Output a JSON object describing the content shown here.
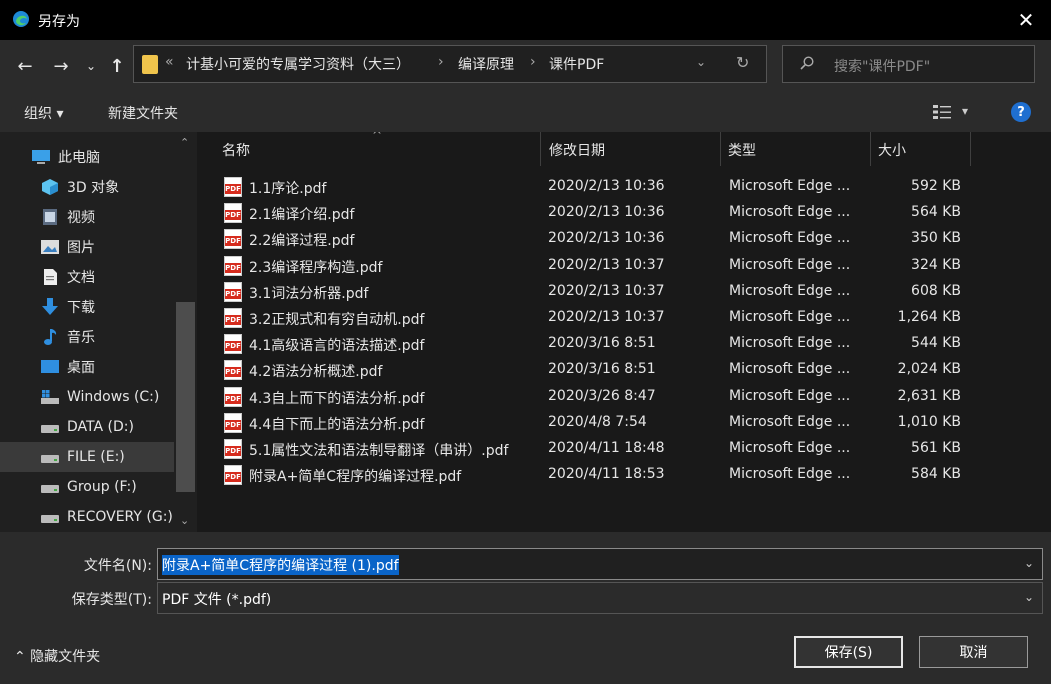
{
  "window": {
    "title": "另存为",
    "close_glyph": "✕"
  },
  "nav": {
    "back_glyph": "←",
    "forward_glyph": "→",
    "recent_glyph": "⌄",
    "up_glyph": "↑",
    "breadcrumb_overflow": "«",
    "breadcrumbs": [
      "计基小可爱的专属学习资料（大三）",
      "编译原理",
      "课件PDF"
    ],
    "separator": "›",
    "dropdown_glyph": "⌄",
    "refresh_glyph": "↻",
    "search_placeholder": "搜索\"课件PDF\""
  },
  "commandbar": {
    "organize": "组织 ▾",
    "new_folder": "新建文件夹",
    "view_dropdown": "▾",
    "help": "?"
  },
  "sidebar": {
    "items": [
      {
        "label": "此电脑",
        "icon": "computer-icon"
      },
      {
        "label": "3D 对象",
        "icon": "3d-objects-icon"
      },
      {
        "label": "视频",
        "icon": "video-icon"
      },
      {
        "label": "图片",
        "icon": "pictures-icon"
      },
      {
        "label": "文档",
        "icon": "documents-icon"
      },
      {
        "label": "下载",
        "icon": "download-icon"
      },
      {
        "label": "音乐",
        "icon": "music-icon"
      },
      {
        "label": "桌面",
        "icon": "desktop-icon"
      },
      {
        "label": "Windows (C:)",
        "icon": "system-drive-icon"
      },
      {
        "label": "DATA (D:)",
        "icon": "drive-icon"
      },
      {
        "label": "FILE (E:)",
        "icon": "drive-icon",
        "selected": true
      },
      {
        "label": "Group (F:)",
        "icon": "drive-icon"
      },
      {
        "label": "RECOVERY (G:)",
        "icon": "drive-icon"
      }
    ],
    "scroll_up": "⌃",
    "scroll_down": "⌄"
  },
  "columns": {
    "name": "名称",
    "modified": "修改日期",
    "type": "类型",
    "size": "大小",
    "sort_caret": "^"
  },
  "files": [
    {
      "name": "1.1序论.pdf",
      "modified": "2020/2/13 10:36",
      "type": "Microsoft Edge ...",
      "size": "592 KB"
    },
    {
      "name": "2.1编译介绍.pdf",
      "modified": "2020/2/13 10:36",
      "type": "Microsoft Edge ...",
      "size": "564 KB"
    },
    {
      "name": "2.2编译过程.pdf",
      "modified": "2020/2/13 10:36",
      "type": "Microsoft Edge ...",
      "size": "350 KB"
    },
    {
      "name": "2.3编译程序构造.pdf",
      "modified": "2020/2/13 10:37",
      "type": "Microsoft Edge ...",
      "size": "324 KB"
    },
    {
      "name": "3.1词法分析器.pdf",
      "modified": "2020/2/13 10:37",
      "type": "Microsoft Edge ...",
      "size": "608 KB"
    },
    {
      "name": "3.2正规式和有穷自动机.pdf",
      "modified": "2020/2/13 10:37",
      "type": "Microsoft Edge ...",
      "size": "1,264 KB"
    },
    {
      "name": "4.1高级语言的语法描述.pdf",
      "modified": "2020/3/16 8:51",
      "type": "Microsoft Edge ...",
      "size": "544 KB"
    },
    {
      "name": "4.2语法分析概述.pdf",
      "modified": "2020/3/16 8:51",
      "type": "Microsoft Edge ...",
      "size": "2,024 KB"
    },
    {
      "name": "4.3自上而下的语法分析.pdf",
      "modified": "2020/3/26 8:47",
      "type": "Microsoft Edge ...",
      "size": "2,631 KB"
    },
    {
      "name": "4.4自下而上的语法分析.pdf",
      "modified": "2020/4/8 7:54",
      "type": "Microsoft Edge ...",
      "size": "1,010 KB"
    },
    {
      "name": "5.1属性文法和语法制导翻译（串讲）.pdf",
      "modified": "2020/4/11 18:48",
      "type": "Microsoft Edge ...",
      "size": "561 KB"
    },
    {
      "name": "附录A+简单C程序的编译过程.pdf",
      "modified": "2020/4/11 18:53",
      "type": "Microsoft Edge ...",
      "size": "584 KB"
    }
  ],
  "pdf_icon_tag": "PDF",
  "bottom": {
    "filename_label": "文件名(N):",
    "filename_value": "附录A+简单C程序的编译过程 (1).pdf",
    "type_label": "保存类型(T):",
    "type_value": "PDF 文件 (*.pdf)",
    "dropdown_glyph": "⌄",
    "hide_folders": "⌃  隐藏文件夹",
    "save_button": "保存(S)",
    "cancel_button": "取消"
  }
}
